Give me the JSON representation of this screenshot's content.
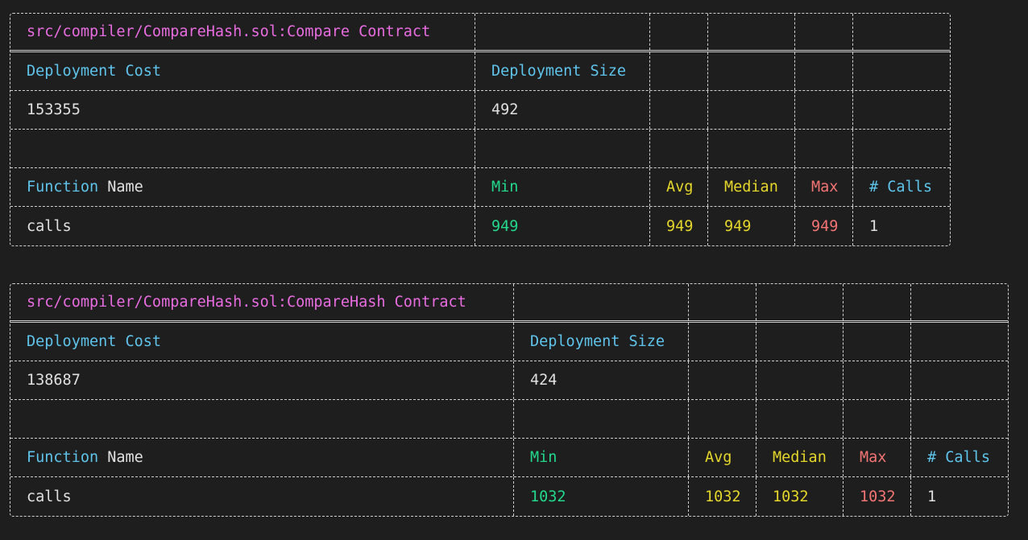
{
  "terminal": {
    "colors": {
      "background": "#1e1e1e",
      "text": "#e0e0e0",
      "contract_name": "#e86ce0",
      "label": "#5fc4ec",
      "min": "#22d88b",
      "avg_median": "#e5d62a",
      "max": "#f47474"
    },
    "tables": [
      {
        "contract_title": "src/compiler/CompareHash.sol:Compare Contract",
        "deployment_cost_label": "Deployment Cost",
        "deployment_size_label": "Deployment Size",
        "deployment_cost": "153355",
        "deployment_size": "492",
        "function_label": "Function",
        "name_label": "Name",
        "columns": {
          "min": "Min",
          "avg": "Avg",
          "median": "Median",
          "max": "Max",
          "calls": "# Calls"
        },
        "rows": [
          {
            "function": "calls",
            "min": "949",
            "avg": "949",
            "median": "949",
            "max": "949",
            "calls": "1"
          }
        ]
      },
      {
        "contract_title": "src/compiler/CompareHash.sol:CompareHash Contract",
        "deployment_cost_label": "Deployment Cost",
        "deployment_size_label": "Deployment Size",
        "deployment_cost": "138687",
        "deployment_size": "424",
        "function_label": "Function",
        "name_label": "Name",
        "columns": {
          "min": "Min",
          "avg": "Avg",
          "median": "Median",
          "max": "Max",
          "calls": "# Calls"
        },
        "rows": [
          {
            "function": "calls",
            "min": "1032",
            "avg": "1032",
            "median": "1032",
            "max": "1032",
            "calls": "1"
          }
        ]
      }
    ]
  }
}
